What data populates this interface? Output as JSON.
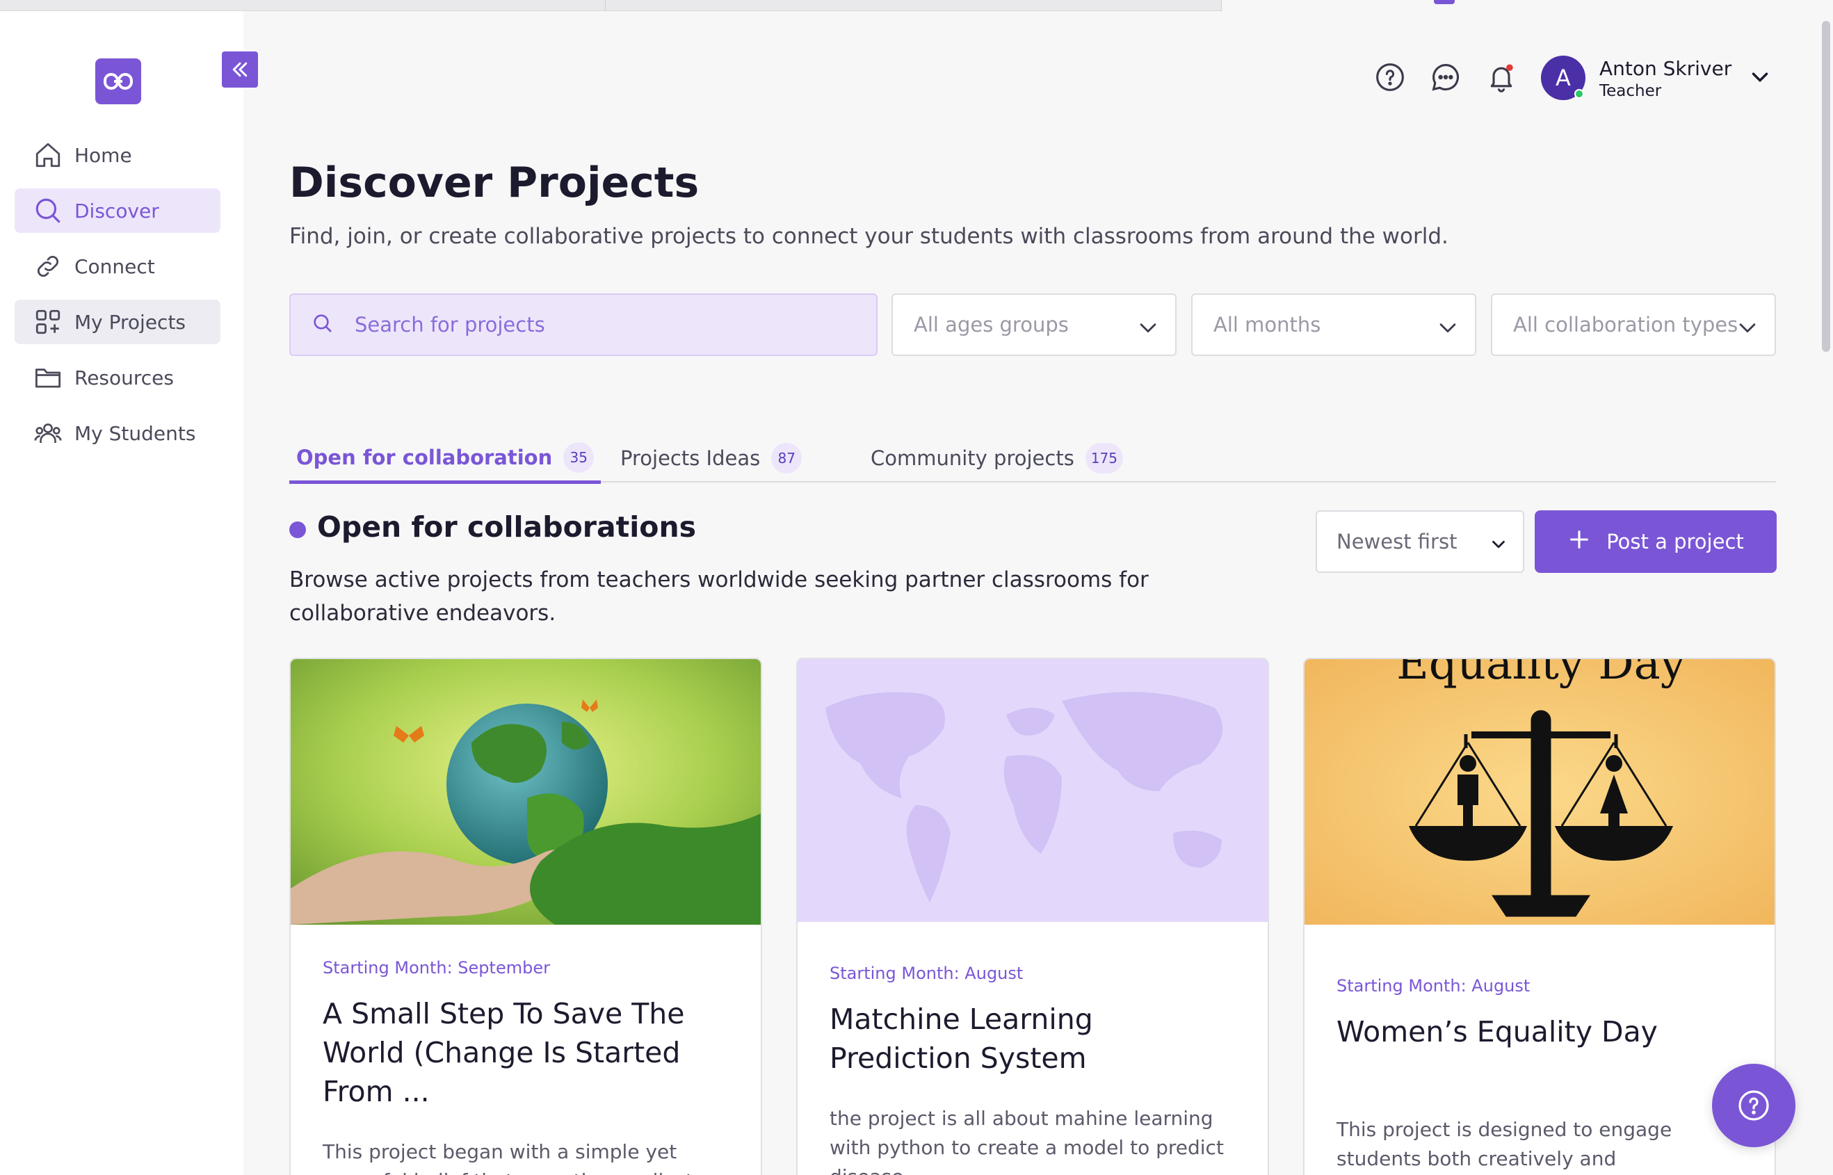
{
  "sidebar": {
    "items": [
      {
        "label": "Home",
        "icon": "home-icon"
      },
      {
        "label": "Discover",
        "icon": "search-icon"
      },
      {
        "label": "Connect",
        "icon": "link-icon"
      },
      {
        "label": "My Projects",
        "icon": "grid-plus-icon"
      },
      {
        "label": "Resources",
        "icon": "folder-icon"
      },
      {
        "label": "My Students",
        "icon": "users-icon"
      }
    ]
  },
  "header": {
    "user": {
      "initial": "A",
      "name": "Anton Skriver",
      "role": "Teacher"
    }
  },
  "page": {
    "title": "Discover Projects",
    "subtitle": "Find, join, or create collaborative projects to connect your students with classrooms from around the world."
  },
  "filters": {
    "search_placeholder": "Search for projects",
    "age": "All ages groups",
    "months": "All months",
    "collaboration": "All collaboration types"
  },
  "tabs": [
    {
      "label": "Open for collaboration",
      "count": "35"
    },
    {
      "label": "Projects Ideas",
      "count": "87"
    },
    {
      "label": "Community projects",
      "count": "175"
    }
  ],
  "section": {
    "title": "Open for collaborations",
    "description": "Browse active projects from teachers worldwide seeking partner classrooms for collaborative endeavors."
  },
  "sort": {
    "value": "Newest first"
  },
  "post_button": "Post a project",
  "cards": [
    {
      "month": "Starting Month: September",
      "title": "A Small Step To Save The World (Change Is Started From ...",
      "desc": "This project began with a simple yet powerful belief that even the smallest"
    },
    {
      "month": "Starting Month: August",
      "title": "Matchine Learning Prediction System",
      "desc": "the project is all about mahine learning with python to create a model to predict disease"
    },
    {
      "month": "Starting Month: August",
      "title": "Women’s Equality Day",
      "desc": "This project is designed to engage students both creatively and intellectually....",
      "image_text": "Equality Day"
    }
  ],
  "colors": {
    "accent": "#7a56d6",
    "accent_light": "#ede6fb",
    "notification": "#e53935"
  }
}
